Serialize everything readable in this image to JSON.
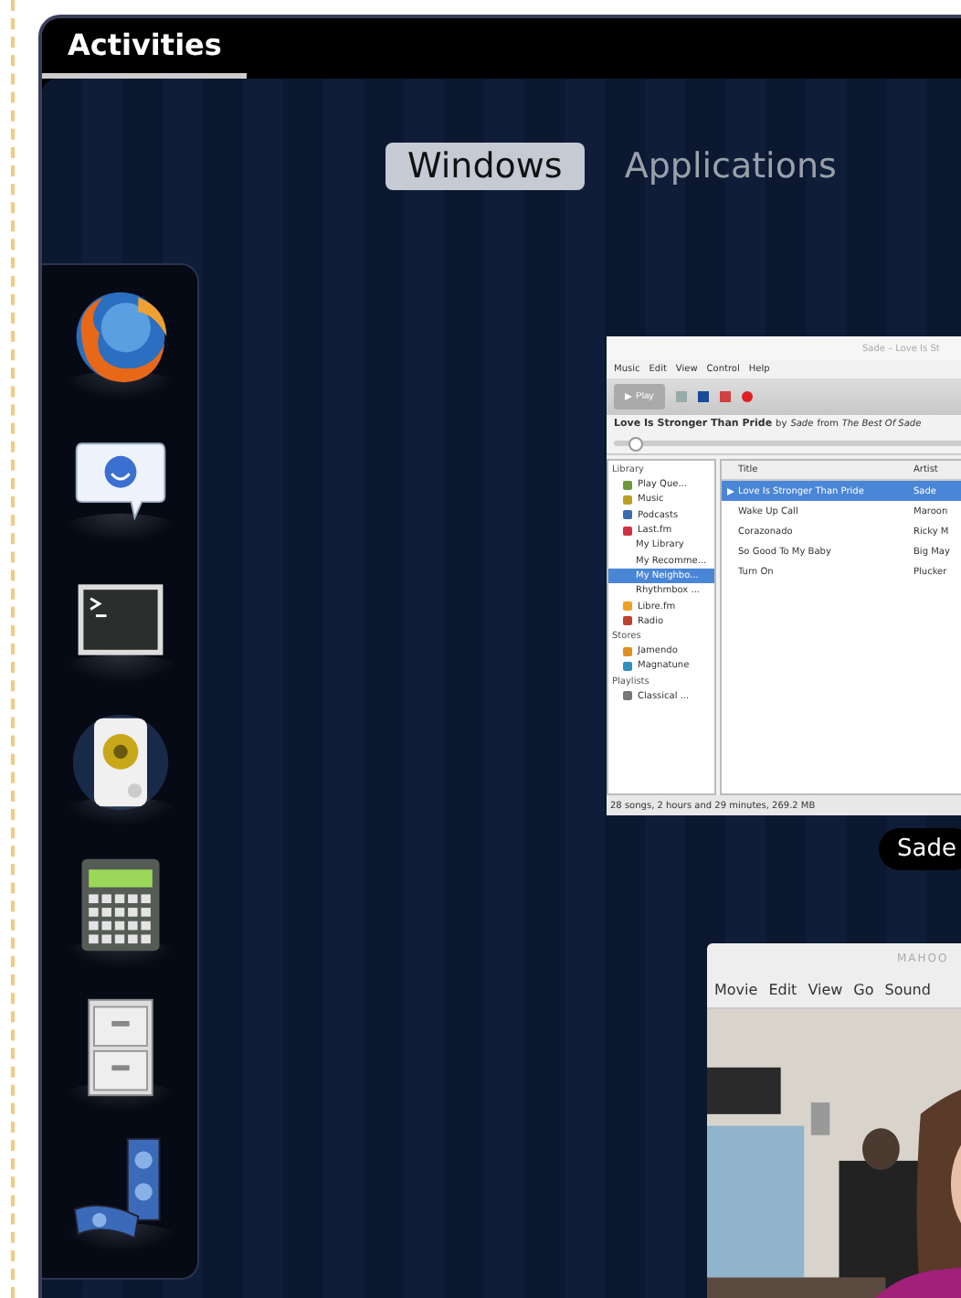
{
  "top_bar": {
    "activities": "Activities"
  },
  "view_tabs": [
    {
      "label": "Windows",
      "selected": true
    },
    {
      "label": "Applications",
      "selected": false
    }
  ],
  "dock": {
    "items": [
      {
        "kind": "browser"
      },
      {
        "kind": "chat"
      },
      {
        "kind": "terminal"
      },
      {
        "kind": "speaker"
      },
      {
        "kind": "calculator"
      },
      {
        "kind": "cabinet"
      },
      {
        "kind": "film"
      }
    ]
  },
  "music_window": {
    "title": "Sade – Love Is St",
    "menu": [
      "Music",
      "Edit",
      "View",
      "Control",
      "Help"
    ],
    "play": "Play",
    "now_playing": "**Love Is Stronger Than Pride** by *Sade* from *The Best Of Sade*",
    "seek": {
      "level": 0.05
    },
    "sidebar": [
      {
        "heading": "Library",
        "items": [
          {
            "label": "Play Que...",
            "kind": "queue",
            "selected": false
          },
          {
            "label": "Music",
            "kind": "music",
            "selected": false
          },
          {
            "label": "Podcasts",
            "kind": "podcast",
            "selected": false
          },
          {
            "label": "Last.fm",
            "kind": "lastfm",
            "selected": false,
            "children": [
              {
                "label": "My Library",
                "selected": false
              },
              {
                "label": "My Recomme...",
                "selected": false
              },
              {
                "label": "My Neighbo...",
                "selected": true
              },
              {
                "label": "Rhythmbox ...",
                "selected": false
              }
            ]
          },
          {
            "label": "Libre.fm",
            "kind": "libre",
            "selected": false
          },
          {
            "label": "Radio",
            "kind": "radio",
            "selected": false
          }
        ]
      },
      {
        "heading": "Stores",
        "items": [
          {
            "label": "Jamendo",
            "kind": "jamendo",
            "selected": false
          },
          {
            "label": "Magnatune",
            "kind": "magnatune",
            "selected": false
          }
        ]
      },
      {
        "heading": "Playlists",
        "items": [
          {
            "label": "Classical ...",
            "kind": "playlist",
            "selected": false
          }
        ]
      }
    ],
    "columns": [
      "Title",
      "Artist"
    ],
    "tracks": [
      {
        "title": "Love Is Stronger Than Pride",
        "artist": "Sade",
        "selected": true,
        "playing": true
      },
      {
        "title": "Wake Up Call",
        "artist": "Maroon",
        "selected": false,
        "playing": false
      },
      {
        "title": "Corazonado",
        "artist": "Ricky M",
        "selected": false,
        "playing": false
      },
      {
        "title": "So Good To My Baby",
        "artist": "Big May",
        "selected": false,
        "playing": false
      },
      {
        "title": "Turn On",
        "artist": "Plucker",
        "selected": false,
        "playing": false
      }
    ],
    "status": "28 songs, 2 hours and 29 minutes, 269.2 MB"
  },
  "window_label": "Sade",
  "video_window": {
    "title": "MAHOO",
    "menu": [
      "Movie",
      "Edit",
      "View",
      "Go",
      "Sound"
    ],
    "video": {
      "kind": "picture"
    }
  }
}
